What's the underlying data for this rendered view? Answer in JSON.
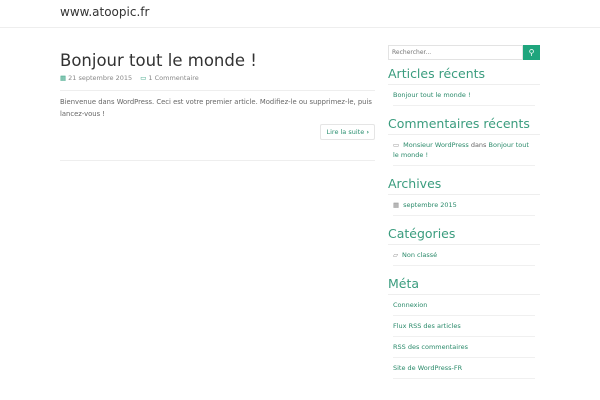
{
  "header": {
    "site_title": "www.atoopic.fr"
  },
  "post": {
    "title": "Bonjour tout le monde !",
    "date": "21 septembre 2015",
    "comments": "1 Commentaire",
    "excerpt": "Bienvenue dans WordPress. Ceci est votre premier article. Modifiez-le ou supprimez-le, puis lancez-vous !",
    "read_more": "Lire la suite"
  },
  "sidebar": {
    "search_placeholder": "Rechercher...",
    "recent_posts": {
      "title": "Articles récents",
      "items": [
        "Bonjour tout le monde !"
      ]
    },
    "recent_comments": {
      "title": "Commentaires récents",
      "author": "Monsieur WordPress",
      "joiner": "dans",
      "post": "Bonjour tout le monde !"
    },
    "archives": {
      "title": "Archives",
      "items": [
        "septembre 2015"
      ]
    },
    "categories": {
      "title": "Catégories",
      "items": [
        "Non classé"
      ]
    },
    "meta": {
      "title": "Méta",
      "items": [
        "Connexion",
        "Flux RSS des articles",
        "RSS des commentaires",
        "Site de WordPress-FR"
      ]
    }
  },
  "colors": {
    "accent": "#1fa57d",
    "heading": "#3a9c7e"
  }
}
